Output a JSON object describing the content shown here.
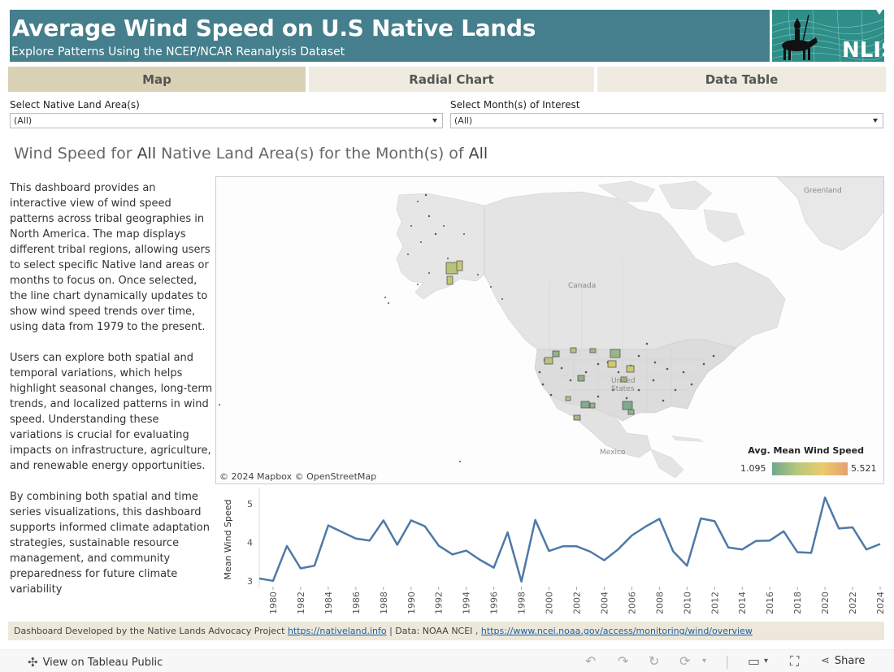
{
  "header": {
    "title": "Average Wind Speed on U.S Native Lands",
    "subtitle": "Explore Patterns Using the NCEP/NCAR Reanalysis Dataset",
    "logo_text": "NLIS",
    "bg_color": "#457e8c"
  },
  "tabs": [
    {
      "label": "Map",
      "active": true
    },
    {
      "label": "Radial Chart",
      "active": false
    },
    {
      "label": "Data Table",
      "active": false
    }
  ],
  "filters": {
    "land_area": {
      "label": "Select Native Land Area(s)",
      "value": "(All)"
    },
    "month": {
      "label": "Select Month(s) of Interest",
      "value": "(All)"
    }
  },
  "viz_title": {
    "prefix": "Wind Speed for ",
    "area": "All",
    "middle": " Native Land Area(s) for the Month(s) of ",
    "month": "All"
  },
  "description": [
    "This dashboard provides an interactive view of wind speed patterns across tribal geographies in North America. The map displays different tribal regions, allowing users to select specific Native land areas or months to focus on. Once selected, the line chart dynamically updates to show wind speed trends over time, using data from 1979 to the present.",
    "Users can explore both spatial and temporal variations, which helps highlight seasonal changes, long-term trends, and localized patterns in wind speed. Understanding these variations is crucial for evaluating impacts on infrastructure, agriculture, and renewable energy opportunities.",
    "By combining both spatial and time series visualizations, this dashboard supports informed climate adaptation strategies, sustainable resource management, and community preparedness for future climate variability"
  ],
  "map": {
    "labels": {
      "greenland": "Greenland",
      "canada": "Canada",
      "united_states": "United States",
      "mexico": "Mexico"
    },
    "attribution": "© 2024 Mapbox  © OpenStreetMap",
    "legend": {
      "title": "Avg. Mean Wind Speed",
      "min": "1.095",
      "max": "5.521",
      "colors": [
        "#6fa88f",
        "#b7c77b",
        "#e9cb6c",
        "#e6a070"
      ]
    }
  },
  "chart_data": {
    "type": "line",
    "ylabel": "Mean Wind Speed",
    "xlabel": "",
    "ylim": [
      2.9,
      5.25
    ],
    "yticks": [
      3,
      4,
      5
    ],
    "xticks": [
      "1980",
      "1982",
      "1984",
      "1986",
      "1988",
      "1990",
      "1992",
      "1994",
      "1996",
      "1998",
      "2000",
      "2002",
      "2004",
      "2006",
      "2008",
      "2010",
      "2012",
      "2014",
      "2016",
      "2018",
      "2020",
      "2022",
      "2024"
    ],
    "x": [
      1979,
      1980,
      1981,
      1982,
      1983,
      1984,
      1985,
      1986,
      1987,
      1988,
      1989,
      1990,
      1991,
      1992,
      1993,
      1994,
      1995,
      1996,
      1997,
      1998,
      1999,
      2000,
      2001,
      2002,
      2003,
      2004,
      2005,
      2006,
      2007,
      2008,
      2009,
      2010,
      2011,
      2012,
      2013,
      2014,
      2015,
      2016,
      2017,
      2018,
      2019,
      2020,
      2021,
      2022,
      2023,
      2024
    ],
    "values": [
      3.07,
      3.01,
      3.91,
      3.33,
      3.4,
      4.44,
      4.27,
      4.1,
      4.05,
      4.57,
      3.94,
      4.57,
      4.42,
      3.92,
      3.69,
      3.79,
      3.55,
      3.35,
      4.26,
      2.99,
      4.58,
      3.78,
      3.9,
      3.9,
      3.76,
      3.54,
      3.82,
      4.18,
      4.41,
      4.61,
      3.77,
      3.4,
      4.62,
      4.55,
      3.87,
      3.82,
      4.04,
      4.05,
      4.29,
      3.75,
      3.73,
      5.16,
      4.36,
      4.39,
      3.82,
      3.96
    ],
    "line_color": "#4e79a7"
  },
  "footer": {
    "text": "Dashboard Developed by the Native Lands Advocacy Project ",
    "link1": "https://nativeland.info",
    "middle": " | Data: NOAA NCEI , ",
    "link2": "https://www.ncei.noaa.gov/access/monitoring/wind/overview"
  },
  "toolbar": {
    "view_label": "View on Tableau Public",
    "share_label": "Share"
  }
}
